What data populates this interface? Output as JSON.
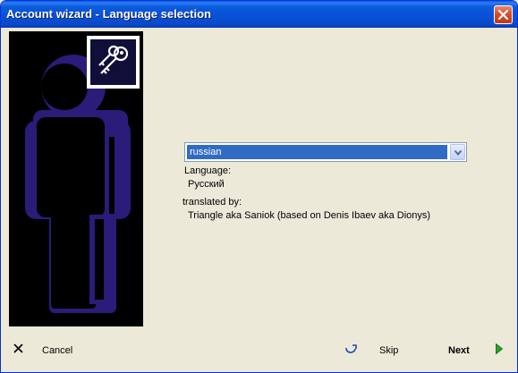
{
  "window": {
    "title": "Account wizard - Language selection"
  },
  "language_select": {
    "selected": "russian",
    "options_visible": [
      "russian"
    ]
  },
  "info": {
    "language_label": "Language:",
    "language_value": "Русский",
    "translator_label": "translated by:",
    "translator_value": "Triangle aka Saniok (based on Denis Ibaev aka Dionys)"
  },
  "footer": {
    "cancel_label": "Cancel",
    "skip_label": "Skip",
    "next_label": "Next"
  },
  "icons": {
    "close": "close-icon",
    "keys": "keys-icon",
    "dropdown": "chevron-down-icon",
    "cancel": "x-icon",
    "skip": "skip-arrow-icon",
    "next": "play-triangle-icon"
  },
  "colors": {
    "title_bar": "#0a5fe6",
    "selection": "#316ac5",
    "figure": "#2a1c78",
    "background": "#ece9d8"
  }
}
